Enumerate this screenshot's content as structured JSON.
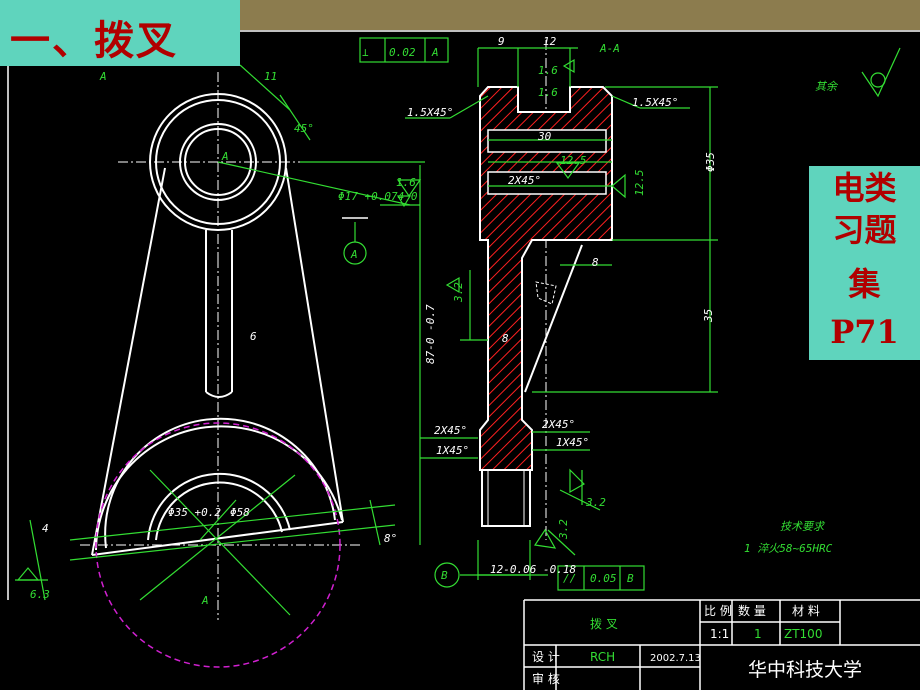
{
  "slide": {
    "title": "一、拨叉",
    "reference": [
      "电类",
      "习题",
      "集",
      "P71"
    ]
  },
  "labels": {
    "perp_symbol": "⊥",
    "perp_value": "0.02",
    "datum_a": "A",
    "datum_b": "B",
    "dim_9": "9",
    "dim_12": "12",
    "section": "A-A",
    "rough_1_6": "1.6",
    "rough_12_5": "12.5",
    "rough_3_2": "3.2",
    "rough_6_3": "6.3",
    "chamfer_1_5": "1.5X45°",
    "chamfer_2": "2X45°",
    "chamfer_1": "1X45°",
    "dim_30": "30",
    "phi35": "Φ35",
    "dim_8": "8",
    "dim_35": "35",
    "dim_12_tol": "12-0.06 -0.18",
    "parallel_symbol": "//",
    "parallel_value": "0.05",
    "rest": "其余",
    "tech_title": "技术要求",
    "tech_1": "1 淬火58~65HRC",
    "dim_11": "11",
    "angle_45": "45°",
    "phi17": "Φ17 +0.074 0",
    "dim_6": "6",
    "dim_87": "87-0 -0.7",
    "phi35_low": "Φ35 +0.2",
    "phi58": "Φ58",
    "dim_4": "4",
    "angle_8": "8°"
  },
  "title_block": {
    "part_name": "拨  叉",
    "scale_label": "比 例",
    "qty_label": "数 量",
    "material_label": "材  料",
    "scale_value": "1:1",
    "qty_value": "1",
    "material_value": "ZT100",
    "design_label": "设 计",
    "designer": "RCH",
    "date": "2002.7.13",
    "review_label": "审 核",
    "school": "华中科技大学"
  },
  "colors": {
    "title_box_bg": "#5fd4bd",
    "title_text": "#b10000",
    "dimension": "#33dd33",
    "hatch": "#ff2020",
    "hidden_line": "#d020d0",
    "top_band": "#8c7c4e"
  }
}
